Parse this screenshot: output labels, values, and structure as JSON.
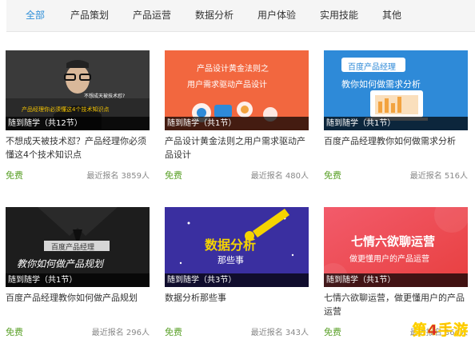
{
  "tabs": [
    "全部",
    "产品策划",
    "产品运营",
    "数据分析",
    "用户体验",
    "实用技能",
    "其他"
  ],
  "active_tab": "全部",
  "courses": [
    {
      "ribbon": "随到随学（共12节）",
      "title": "不想成天被技术怼？产品经理你必须懂这4个技术知识点",
      "price": "免费",
      "enroll": "最近报名 3859人",
      "overlay": [
        "不想成天被技术怼?",
        "产品经理你必须懂这4个技术知识点"
      ]
    },
    {
      "ribbon": "随到随学（共1节）",
      "title": "产品设计黄金法则之用户需求驱动产品设计",
      "price": "免费",
      "enroll": "最近报名 480人",
      "overlay": [
        "产品设计黄金法则之",
        "用户需求驱动产品设计"
      ]
    },
    {
      "ribbon": "随到随学（共1节）",
      "title": "百度产品经理教你如何做需求分析",
      "price": "免费",
      "enroll": "最近报名 516人",
      "overlay": [
        "百度产品经理",
        "教你如何做需求分析"
      ]
    },
    {
      "ribbon": "随到随学（共1节）",
      "title": "百度产品经理教你如何做产品规划",
      "price": "免费",
      "enroll": "最近报名 296人",
      "overlay": [
        "百度产品经理",
        "教你如何做产品规划"
      ]
    },
    {
      "ribbon": "随到随学（共3节）",
      "title": "数据分析那些事",
      "price": "免费",
      "enroll": "最近报名 343人",
      "overlay": [
        "数据分析",
        "那些事"
      ]
    },
    {
      "ribbon": "随到随学（共1节）",
      "title": "七情六欲聊运营，做更懂用户的产品运营",
      "price": "免费",
      "enroll": "最近报名 364人",
      "overlay": [
        "七情六欲聊运营",
        "做更懂用户的产品运营"
      ]
    }
  ],
  "watermark": "第4手游",
  "colors": {
    "accent": "#2f8fd8",
    "free_green": "#5aa028",
    "thumb_orange": "#f2673f",
    "thumb_blue": "#2e8ad8",
    "thumb_purple": "#3a2fa0",
    "thumb_red": "#e84b4b"
  }
}
